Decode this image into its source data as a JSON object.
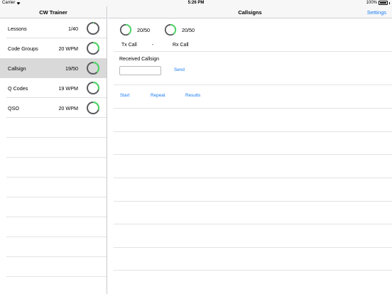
{
  "status_bar": {
    "carrier": "Carrier",
    "time": "5:26 PM",
    "battery": "100%"
  },
  "sidebar": {
    "title": "CW Trainer",
    "items": [
      {
        "label": "Lessons",
        "value": "1/40",
        "progress": 0.025,
        "selected": false
      },
      {
        "label": "Code Groups",
        "value": "20 WPM",
        "progress": 0.3,
        "selected": false
      },
      {
        "label": "Callsign",
        "value": "19/50",
        "progress": 0.38,
        "selected": true
      },
      {
        "label": "Q Codes",
        "value": "19 WPM",
        "progress": 0.3,
        "selected": false
      },
      {
        "label": "QSO",
        "value": "20 WPM",
        "progress": 0.3,
        "selected": false
      }
    ]
  },
  "main": {
    "title": "Callsigns",
    "settings_label": "Settings",
    "stat_left": {
      "value": "20/50",
      "progress": 0.4
    },
    "stat_right": {
      "value": "20/50",
      "progress": 0.4
    },
    "tx_label": "Tx Call",
    "separator": "-",
    "rx_label": "Rx Call",
    "received_label": "Received Callsign",
    "input_value": "",
    "input_placeholder": "",
    "send_label": "Send",
    "start_label": "Start",
    "repeat_label": "Repeat",
    "results_label": "Results"
  },
  "colors": {
    "accent": "#1a7cf5",
    "ring_progress": "#4cd964",
    "ring_track": "#5a5a5e",
    "selected_row": "#d9d9d9"
  }
}
